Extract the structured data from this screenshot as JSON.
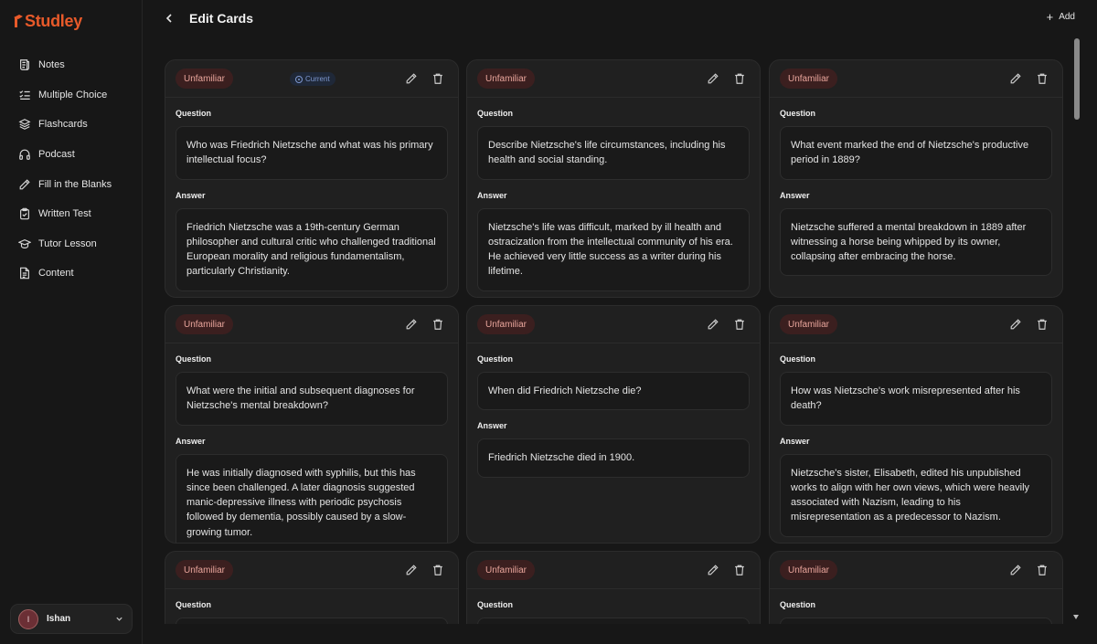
{
  "app": {
    "name": "Studley",
    "brand_color": "#e85a2a"
  },
  "sidebar": {
    "items": [
      {
        "label": "Notes",
        "icon": "notes-icon"
      },
      {
        "label": "Multiple Choice",
        "icon": "checklist-icon"
      },
      {
        "label": "Flashcards",
        "icon": "layers-icon"
      },
      {
        "label": "Podcast",
        "icon": "headphones-icon"
      },
      {
        "label": "Fill in the Blanks",
        "icon": "pencil-icon"
      },
      {
        "label": "Written Test",
        "icon": "clipboard-check-icon"
      },
      {
        "label": "Tutor Lesson",
        "icon": "graduation-cap-icon"
      },
      {
        "label": "Content",
        "icon": "document-icon"
      }
    ],
    "user": {
      "initial": "I",
      "name": "Ishan"
    }
  },
  "header": {
    "title": "Edit Cards",
    "add_label": "Add"
  },
  "labels": {
    "question": "Question",
    "answer": "Answer"
  },
  "cards": [
    {
      "badge": "Unfamiliar",
      "current": "Current",
      "question": "Who was Friedrich Nietzsche and what was his primary intellectual focus?",
      "answer": "Friedrich Nietzsche was a 19th-century German philosopher and cultural critic who challenged traditional European morality and religious fundamentalism, particularly Christianity."
    },
    {
      "badge": "Unfamiliar",
      "question": "Describe Nietzsche's life circumstances, including his health and social standing.",
      "answer": "Nietzsche's life was difficult, marked by ill health and ostracization from the intellectual community of his era. He achieved very little success as a writer during his lifetime."
    },
    {
      "badge": "Unfamiliar",
      "question": "What event marked the end of Nietzsche's productive period in 1889?",
      "answer": "Nietzsche suffered a mental breakdown in 1889 after witnessing a horse being whipped by its owner, collapsing after embracing the horse."
    },
    {
      "badge": "Unfamiliar",
      "question": "What were the initial and subsequent diagnoses for Nietzsche's mental breakdown?",
      "answer": "He was initially diagnosed with syphilis, but this has since been challenged. A later diagnosis suggested manic-depressive illness with periodic psychosis followed by dementia, possibly caused by a slow-growing tumor."
    },
    {
      "badge": "Unfamiliar",
      "question": "When did Friedrich Nietzsche die?",
      "answer": "Friedrich Nietzsche died in 1900."
    },
    {
      "badge": "Unfamiliar",
      "question": "How was Nietzsche's work misrepresented after his death?",
      "answer": "Nietzsche's sister, Elisabeth, edited his unpublished works to align with her own views, which were heavily associated with Nazism, leading to his misrepresentation as a predecessor to Nazism."
    },
    {
      "badge": "Unfamiliar"
    },
    {
      "badge": "Unfamiliar"
    },
    {
      "badge": "Unfamiliar"
    }
  ]
}
